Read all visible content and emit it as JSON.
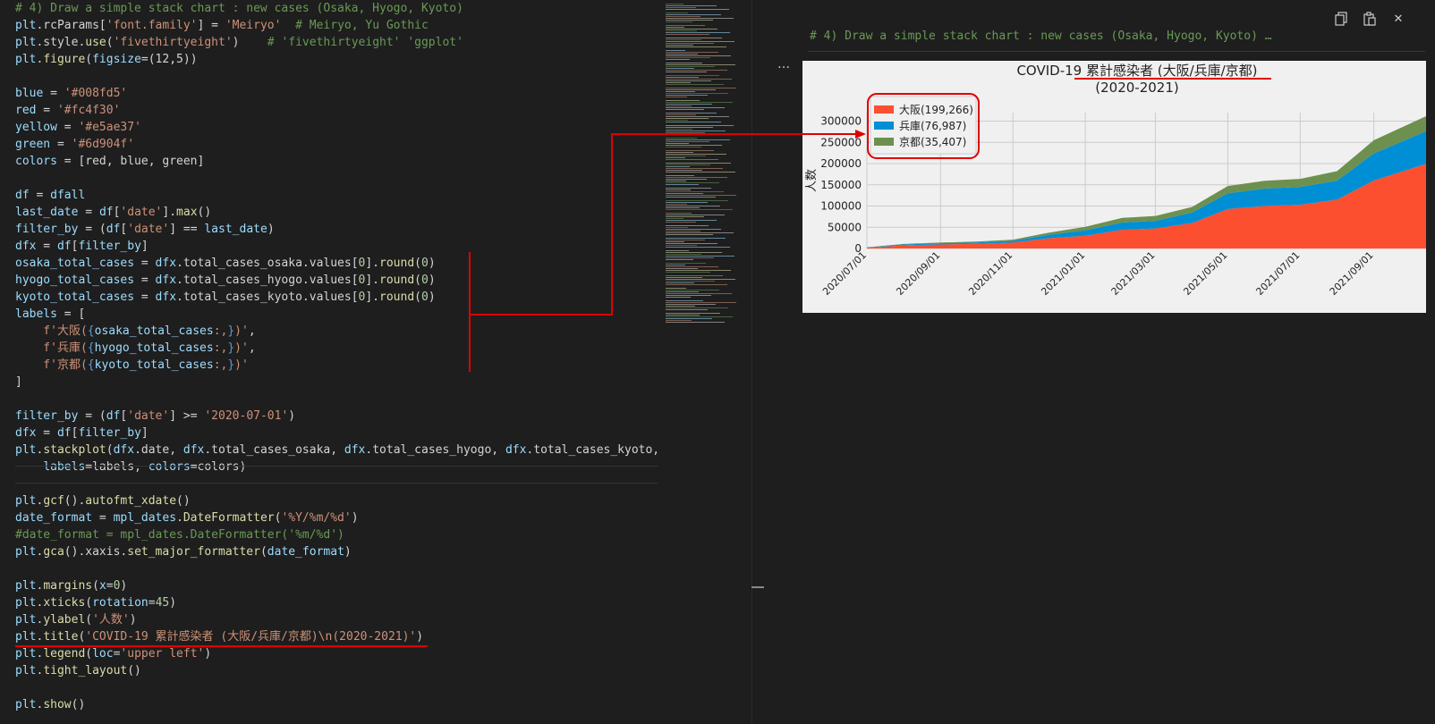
{
  "editor": {
    "lines": [
      [
        {
          "t": "# 4) Draw a simple stack chart : new cases (Osaka, Hyogo, Kyoto)",
          "c": "comment"
        }
      ],
      [
        {
          "t": "plt",
          "c": "var"
        },
        {
          "t": ".rcParams[",
          "c": "plain"
        },
        {
          "t": "'font.family'",
          "c": "string"
        },
        {
          "t": "] = ",
          "c": "plain"
        },
        {
          "t": "'Meiryo'",
          "c": "string"
        },
        {
          "t": "  # Meiryo, Yu Gothic",
          "c": "comment"
        }
      ],
      [
        {
          "t": "plt",
          "c": "var"
        },
        {
          "t": ".style.",
          "c": "plain"
        },
        {
          "t": "use",
          "c": "func"
        },
        {
          "t": "(",
          "c": "plain"
        },
        {
          "t": "'fivethirtyeight'",
          "c": "string"
        },
        {
          "t": ")    ",
          "c": "plain"
        },
        {
          "t": "# 'fivethirtyeight' 'ggplot'",
          "c": "comment"
        }
      ],
      [
        {
          "t": "plt",
          "c": "var"
        },
        {
          "t": ".",
          "c": "plain"
        },
        {
          "t": "figure",
          "c": "func"
        },
        {
          "t": "(",
          "c": "plain"
        },
        {
          "t": "figsize",
          "c": "var"
        },
        {
          "t": "=(12,5))",
          "c": "plain"
        }
      ],
      [
        {
          "t": "",
          "c": "plain"
        }
      ],
      [
        {
          "t": "blue",
          "c": "var"
        },
        {
          "t": " = ",
          "c": "plain"
        },
        {
          "t": "'#008fd5'",
          "c": "string"
        }
      ],
      [
        {
          "t": "red",
          "c": "var"
        },
        {
          "t": " = ",
          "c": "plain"
        },
        {
          "t": "'#fc4f30'",
          "c": "string"
        }
      ],
      [
        {
          "t": "yellow",
          "c": "var"
        },
        {
          "t": " = ",
          "c": "plain"
        },
        {
          "t": "'#e5ae37'",
          "c": "string"
        }
      ],
      [
        {
          "t": "green",
          "c": "var"
        },
        {
          "t": " = ",
          "c": "plain"
        },
        {
          "t": "'#6d904f'",
          "c": "string"
        }
      ],
      [
        {
          "t": "colors",
          "c": "var"
        },
        {
          "t": " = [red, blue, green]",
          "c": "plain"
        }
      ],
      [
        {
          "t": "",
          "c": "plain"
        }
      ],
      [
        {
          "t": "df",
          "c": "var"
        },
        {
          "t": " = ",
          "c": "plain"
        },
        {
          "t": "dfall",
          "c": "var"
        }
      ],
      [
        {
          "t": "last_date",
          "c": "var"
        },
        {
          "t": " = ",
          "c": "plain"
        },
        {
          "t": "df",
          "c": "var"
        },
        {
          "t": "[",
          "c": "plain"
        },
        {
          "t": "'date'",
          "c": "string"
        },
        {
          "t": "].",
          "c": "plain"
        },
        {
          "t": "max",
          "c": "func"
        },
        {
          "t": "()",
          "c": "plain"
        }
      ],
      [
        {
          "t": "filter_by",
          "c": "var"
        },
        {
          "t": " = (",
          "c": "plain"
        },
        {
          "t": "df",
          "c": "var"
        },
        {
          "t": "[",
          "c": "plain"
        },
        {
          "t": "'date'",
          "c": "string"
        },
        {
          "t": "] == ",
          "c": "plain"
        },
        {
          "t": "last_date",
          "c": "var"
        },
        {
          "t": ")",
          "c": "plain"
        }
      ],
      [
        {
          "t": "dfx",
          "c": "var"
        },
        {
          "t": " = ",
          "c": "plain"
        },
        {
          "t": "df",
          "c": "var"
        },
        {
          "t": "[",
          "c": "plain"
        },
        {
          "t": "filter_by",
          "c": "var"
        },
        {
          "t": "]",
          "c": "plain"
        }
      ],
      [
        {
          "t": "osaka_total_cases",
          "c": "var"
        },
        {
          "t": " = ",
          "c": "plain"
        },
        {
          "t": "dfx",
          "c": "var"
        },
        {
          "t": ".total_cases_osaka.values[",
          "c": "plain"
        },
        {
          "t": "0",
          "c": "num"
        },
        {
          "t": "].",
          "c": "plain"
        },
        {
          "t": "round",
          "c": "func"
        },
        {
          "t": "(",
          "c": "plain"
        },
        {
          "t": "0",
          "c": "num"
        },
        {
          "t": ")",
          "c": "plain"
        }
      ],
      [
        {
          "t": "hyogo_total_cases",
          "c": "var"
        },
        {
          "t": " = ",
          "c": "plain"
        },
        {
          "t": "dfx",
          "c": "var"
        },
        {
          "t": ".total_cases_hyogo.values[",
          "c": "plain"
        },
        {
          "t": "0",
          "c": "num"
        },
        {
          "t": "].",
          "c": "plain"
        },
        {
          "t": "round",
          "c": "func"
        },
        {
          "t": "(",
          "c": "plain"
        },
        {
          "t": "0",
          "c": "num"
        },
        {
          "t": ")",
          "c": "plain"
        }
      ],
      [
        {
          "t": "kyoto_total_cases",
          "c": "var"
        },
        {
          "t": " = ",
          "c": "plain"
        },
        {
          "t": "dfx",
          "c": "var"
        },
        {
          "t": ".total_cases_kyoto.values[",
          "c": "plain"
        },
        {
          "t": "0",
          "c": "num"
        },
        {
          "t": "].",
          "c": "plain"
        },
        {
          "t": "round",
          "c": "func"
        },
        {
          "t": "(",
          "c": "plain"
        },
        {
          "t": "0",
          "c": "num"
        },
        {
          "t": ")",
          "c": "plain"
        }
      ],
      [
        {
          "t": "labels",
          "c": "var"
        },
        {
          "t": " = [",
          "c": "plain"
        }
      ],
      [
        {
          "t": "    f'大阪(",
          "c": "string"
        },
        {
          "t": "{",
          "c": "brace"
        },
        {
          "t": "osaka_total_cases",
          "c": "var"
        },
        {
          "t": ":,",
          "c": "string"
        },
        {
          "t": "}",
          "c": "brace"
        },
        {
          "t": ")'",
          "c": "string"
        },
        {
          "t": ",",
          "c": "plain"
        }
      ],
      [
        {
          "t": "    f'兵庫(",
          "c": "string"
        },
        {
          "t": "{",
          "c": "brace"
        },
        {
          "t": "hyogo_total_cases",
          "c": "var"
        },
        {
          "t": ":,",
          "c": "string"
        },
        {
          "t": "}",
          "c": "brace"
        },
        {
          "t": ")'",
          "c": "string"
        },
        {
          "t": ",",
          "c": "plain"
        }
      ],
      [
        {
          "t": "    f'京都(",
          "c": "string"
        },
        {
          "t": "{",
          "c": "brace"
        },
        {
          "t": "kyoto_total_cases",
          "c": "var"
        },
        {
          "t": ":,",
          "c": "string"
        },
        {
          "t": "}",
          "c": "brace"
        },
        {
          "t": ")'",
          "c": "string"
        }
      ],
      [
        {
          "t": "]",
          "c": "plain"
        }
      ],
      [
        {
          "t": "",
          "c": "plain"
        }
      ],
      [
        {
          "t": "filter_by",
          "c": "var"
        },
        {
          "t": " = (",
          "c": "plain"
        },
        {
          "t": "df",
          "c": "var"
        },
        {
          "t": "[",
          "c": "plain"
        },
        {
          "t": "'date'",
          "c": "string"
        },
        {
          "t": "] >= ",
          "c": "plain"
        },
        {
          "t": "'2020-07-01'",
          "c": "string"
        },
        {
          "t": ")",
          "c": "plain"
        }
      ],
      [
        {
          "t": "dfx",
          "c": "var"
        },
        {
          "t": " = ",
          "c": "plain"
        },
        {
          "t": "df",
          "c": "var"
        },
        {
          "t": "[",
          "c": "plain"
        },
        {
          "t": "filter_by",
          "c": "var"
        },
        {
          "t": "]",
          "c": "plain"
        }
      ],
      [
        {
          "t": "plt",
          "c": "var"
        },
        {
          "t": ".",
          "c": "plain"
        },
        {
          "t": "stackplot",
          "c": "func"
        },
        {
          "t": "(",
          "c": "plain"
        },
        {
          "t": "dfx",
          "c": "var"
        },
        {
          "t": ".date, ",
          "c": "plain"
        },
        {
          "t": "dfx",
          "c": "var"
        },
        {
          "t": ".total_cases_osaka, ",
          "c": "plain"
        },
        {
          "t": "dfx",
          "c": "var"
        },
        {
          "t": ".total_cases_hyogo, ",
          "c": "plain"
        },
        {
          "t": "dfx",
          "c": "var"
        },
        {
          "t": ".total_cases_kyoto,",
          "c": "plain"
        }
      ],
      [
        {
          "t": "    ",
          "c": "plain"
        },
        {
          "t": "labels",
          "c": "var"
        },
        {
          "t": "=labels, ",
          "c": "plain"
        },
        {
          "t": "colors",
          "c": "var"
        },
        {
          "t": "=colors)",
          "c": "plain"
        }
      ],
      [
        {
          "t": "",
          "c": "plain"
        }
      ],
      [
        {
          "t": "plt",
          "c": "var"
        },
        {
          "t": ".",
          "c": "plain"
        },
        {
          "t": "gcf",
          "c": "func"
        },
        {
          "t": "().",
          "c": "plain"
        },
        {
          "t": "autofmt_xdate",
          "c": "func"
        },
        {
          "t": "()",
          "c": "plain"
        }
      ],
      [
        {
          "t": "date_format",
          "c": "var"
        },
        {
          "t": " = ",
          "c": "plain"
        },
        {
          "t": "mpl_dates",
          "c": "var"
        },
        {
          "t": ".",
          "c": "plain"
        },
        {
          "t": "DateFormatter",
          "c": "func"
        },
        {
          "t": "(",
          "c": "plain"
        },
        {
          "t": "'%Y/%m/%d'",
          "c": "string"
        },
        {
          "t": ")",
          "c": "plain"
        }
      ],
      [
        {
          "t": "#date_format = mpl_dates.DateFormatter('%m/%d')",
          "c": "comment"
        }
      ],
      [
        {
          "t": "plt",
          "c": "var"
        },
        {
          "t": ".",
          "c": "plain"
        },
        {
          "t": "gca",
          "c": "func"
        },
        {
          "t": "().xaxis.",
          "c": "plain"
        },
        {
          "t": "set_major_formatter",
          "c": "func"
        },
        {
          "t": "(",
          "c": "plain"
        },
        {
          "t": "date_format",
          "c": "var"
        },
        {
          "t": ")",
          "c": "plain"
        }
      ],
      [
        {
          "t": "",
          "c": "plain"
        }
      ],
      [
        {
          "t": "plt",
          "c": "var"
        },
        {
          "t": ".",
          "c": "plain"
        },
        {
          "t": "margins",
          "c": "func"
        },
        {
          "t": "(",
          "c": "plain"
        },
        {
          "t": "x",
          "c": "var"
        },
        {
          "t": "=",
          "c": "plain"
        },
        {
          "t": "0",
          "c": "num"
        },
        {
          "t": ")",
          "c": "plain"
        }
      ],
      [
        {
          "t": "plt",
          "c": "var"
        },
        {
          "t": ".",
          "c": "plain"
        },
        {
          "t": "xticks",
          "c": "func"
        },
        {
          "t": "(",
          "c": "plain"
        },
        {
          "t": "rotation",
          "c": "var"
        },
        {
          "t": "=",
          "c": "plain"
        },
        {
          "t": "45",
          "c": "num"
        },
        {
          "t": ")",
          "c": "plain"
        }
      ],
      [
        {
          "t": "plt",
          "c": "var"
        },
        {
          "t": ".",
          "c": "plain"
        },
        {
          "t": "ylabel",
          "c": "func"
        },
        {
          "t": "(",
          "c": "plain"
        },
        {
          "t": "'人数'",
          "c": "string"
        },
        {
          "t": ")",
          "c": "plain"
        }
      ],
      [
        {
          "t": "plt",
          "c": "var"
        },
        {
          "t": ".",
          "c": "plain"
        },
        {
          "t": "title",
          "c": "func"
        },
        {
          "t": "(",
          "c": "plain"
        },
        {
          "t": "'COVID-19 累計感染者 (大阪/兵庫/京都)\\n(2020-2021)'",
          "c": "string"
        },
        {
          "t": ")",
          "c": "plain"
        }
      ],
      [
        {
          "t": "plt",
          "c": "var"
        },
        {
          "t": ".",
          "c": "plain"
        },
        {
          "t": "legend",
          "c": "func"
        },
        {
          "t": "(",
          "c": "plain"
        },
        {
          "t": "loc",
          "c": "var"
        },
        {
          "t": "=",
          "c": "plain"
        },
        {
          "t": "'upper left'",
          "c": "string"
        },
        {
          "t": ")",
          "c": "plain"
        }
      ],
      [
        {
          "t": "plt",
          "c": "var"
        },
        {
          "t": ".",
          "c": "plain"
        },
        {
          "t": "tight_layout",
          "c": "func"
        },
        {
          "t": "()",
          "c": "plain"
        }
      ],
      [
        {
          "t": "",
          "c": "plain"
        }
      ],
      [
        {
          "t": "plt",
          "c": "var"
        },
        {
          "t": ".",
          "c": "plain"
        },
        {
          "t": "show",
          "c": "func"
        },
        {
          "t": "()",
          "c": "plain"
        }
      ]
    ]
  },
  "output": {
    "header": "# 4) Draw a simple stack chart : new cases (Osaka, Hyogo, Kyoto) …",
    "menu_glyph": "…",
    "toolbar": {
      "copy_icon": "copy-icon",
      "paste_icon": "paste-icon",
      "close_glyph": "✕"
    }
  },
  "colors": {
    "osaka": "#fc4f30",
    "hyogo": "#008fd5",
    "kyoto": "#6d904f",
    "annotation": "#e00000"
  },
  "chart_data": {
    "type": "area",
    "stacked": true,
    "title_line1": "COVID-19 累計感染者 (大阪/兵庫/京都)",
    "title_line2": "(2020-2021)",
    "ylabel": "人数",
    "xlabel": "",
    "ylim": [
      0,
      320000
    ],
    "yticks": [
      0,
      50000,
      100000,
      150000,
      200000,
      250000,
      300000
    ],
    "xlim": [
      "2020-07-01",
      "2021-10-15"
    ],
    "xticks": [
      "2020/07/01",
      "2020/09/01",
      "2020/11/01",
      "2021/01/01",
      "2021/03/01",
      "2021/05/01",
      "2021/07/01",
      "2021/09/01"
    ],
    "grid": true,
    "legend_position": "upper-left",
    "x": [
      "2020-07-01",
      "2020-08-01",
      "2020-09-01",
      "2020-10-01",
      "2020-11-01",
      "2020-12-01",
      "2021-01-01",
      "2021-02-01",
      "2021-03-01",
      "2021-04-01",
      "2021-05-01",
      "2021-06-01",
      "2021-07-01",
      "2021-08-01",
      "2021-09-01",
      "2021-10-15"
    ],
    "series": [
      {
        "name": "大阪(199,266)",
        "color": "#fc4f30",
        "values": [
          1800,
          7500,
          9500,
          11000,
          14000,
          24000,
          30000,
          44000,
          47000,
          60000,
          93000,
          100000,
          103000,
          115000,
          160000,
          199266
        ]
      },
      {
        "name": "兵庫(76,987)",
        "color": "#008fd5",
        "values": [
          700,
          2200,
          2800,
          3200,
          4200,
          8000,
          13000,
          17000,
          18000,
          25000,
          37000,
          41000,
          42000,
          45000,
          64000,
          76987
        ]
      },
      {
        "name": "京都(35,407)",
        "color": "#6d904f",
        "values": [
          400,
          1200,
          1600,
          2000,
          2600,
          5000,
          8000,
          11000,
          11500,
          13000,
          17000,
          18500,
          19000,
          22000,
          31000,
          35407
        ]
      }
    ]
  }
}
